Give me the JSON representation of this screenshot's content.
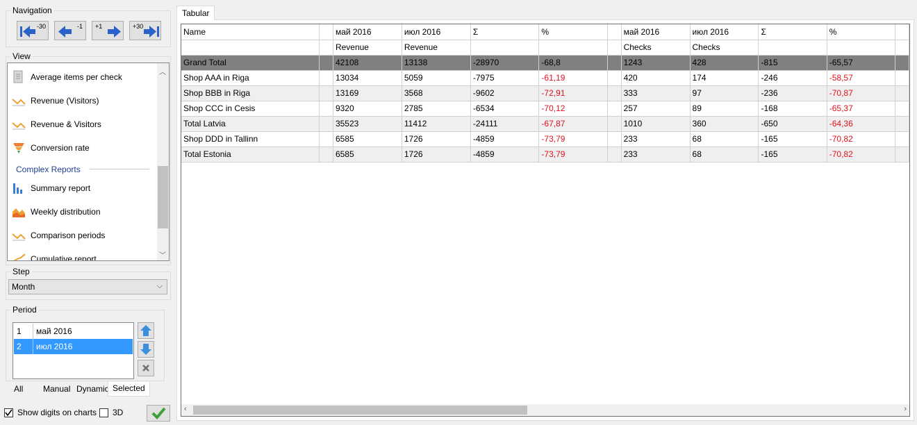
{
  "navigation": {
    "title": "Navigation",
    "buttons": [
      {
        "label": "-30"
      },
      {
        "label": "-1"
      },
      {
        "label": "+1"
      },
      {
        "label": "+30"
      }
    ]
  },
  "view": {
    "title": "View",
    "items": [
      {
        "label": "Average items per check",
        "icon": "receipt-icon"
      },
      {
        "label": "Revenue (Visitors)",
        "icon": "trend-line-icon"
      },
      {
        "label": "Revenue & Visitors",
        "icon": "trend-line-icon"
      },
      {
        "label": "Conversion rate",
        "icon": "funnel-icon"
      }
    ],
    "section_heading": "Complex Reports",
    "complex_items": [
      {
        "label": "Summary report",
        "icon": "bar-chart-icon"
      },
      {
        "label": "Weekly distribution",
        "icon": "area-chart-icon"
      },
      {
        "label": "Comparison periods",
        "icon": "trend-line-icon"
      },
      {
        "label": "Cumulative report",
        "icon": "trend-line-icon"
      }
    ]
  },
  "step": {
    "title": "Step",
    "selected": "Month"
  },
  "period": {
    "title": "Period",
    "rows": [
      {
        "num": "1",
        "value": "май 2016",
        "selected": false
      },
      {
        "num": "2",
        "value": "июл 2016",
        "selected": true
      }
    ],
    "tabs": [
      "All",
      "Manual",
      "Dynamic",
      "Selected"
    ],
    "active_tab": "Selected"
  },
  "options": {
    "show_digits_label": "Show digits on charts",
    "show_digits_checked": true,
    "three_d_label": "3D",
    "three_d_checked": false
  },
  "tabular": {
    "tab_label": "Tabular",
    "header1": [
      "Name",
      "",
      "май 2016",
      "июл 2016",
      "Σ",
      "%",
      "",
      "май 2016",
      "июл 2016",
      "Σ",
      "%"
    ],
    "header2": [
      "",
      "",
      "Revenue",
      "Revenue",
      "",
      "",
      "",
      "Checks",
      "Checks",
      "",
      ""
    ],
    "rows": [
      {
        "cells": [
          "Grand Total",
          "",
          "42108",
          "13138",
          "-28970",
          "-68,8",
          "",
          "1243",
          "428",
          "-815",
          "-65,57"
        ]
      },
      {
        "cells": [
          "Shop AAA in Riga",
          "",
          "13034",
          "5059",
          "-7975",
          "-61,19",
          "",
          "420",
          "174",
          "-246",
          "-58,57"
        ]
      },
      {
        "cells": [
          "Shop BBB in Riga",
          "",
          "13169",
          "3568",
          "-9602",
          "-72,91",
          "",
          "333",
          "97",
          "-236",
          "-70,87"
        ]
      },
      {
        "cells": [
          "Shop CCC in Cesis",
          "",
          "9320",
          "2785",
          "-6534",
          "-70,12",
          "",
          "257",
          "89",
          "-168",
          "-65,37"
        ]
      },
      {
        "cells": [
          "Total Latvia",
          "",
          "35523",
          "11412",
          "-24111",
          "-67,87",
          "",
          "1010",
          "360",
          "-650",
          "-64,36"
        ]
      },
      {
        "cells": [
          "Shop DDD in Tallinn",
          "",
          "6585",
          "1726",
          "-4859",
          "-73,79",
          "",
          "233",
          "68",
          "-165",
          "-70,82"
        ]
      },
      {
        "cells": [
          "Total Estonia",
          "",
          "6585",
          "1726",
          "-4859",
          "-73,79",
          "",
          "233",
          "68",
          "-165",
          "-70,82"
        ]
      }
    ]
  },
  "colors": {
    "negative": "#e0121c",
    "selection": "#3399ff",
    "grand_total_bg": "#808080",
    "heading_blue": "#1f3f93"
  }
}
